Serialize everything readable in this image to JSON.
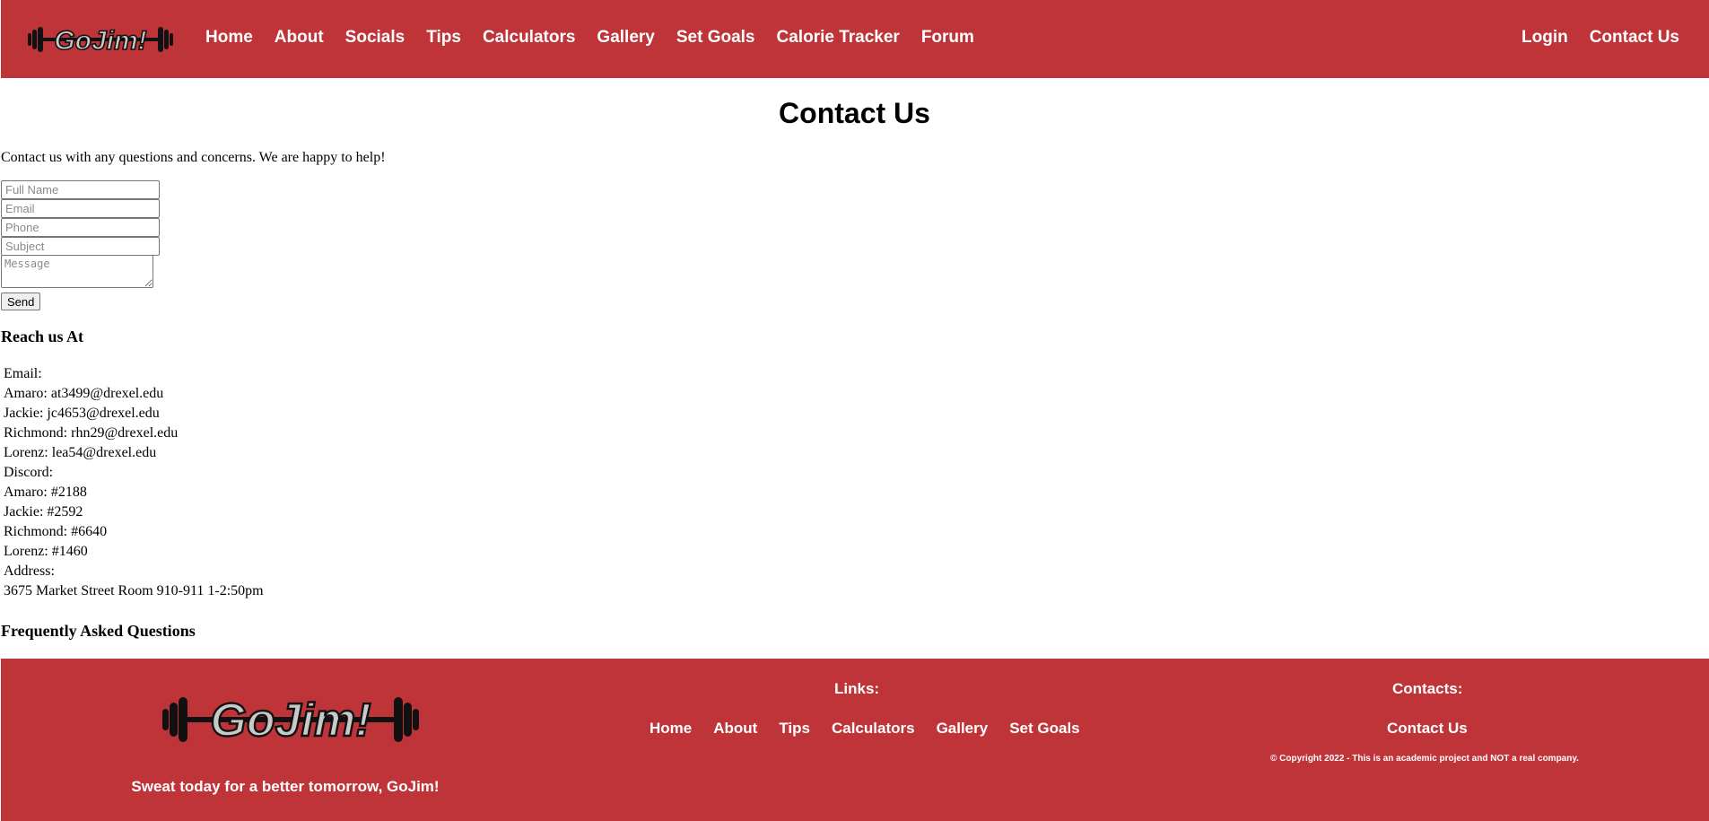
{
  "brand": {
    "logo_text": "GoJim!"
  },
  "nav": {
    "links": [
      "Home",
      "About",
      "Socials",
      "Tips",
      "Calculators",
      "Gallery",
      "Set Goals",
      "Calorie Tracker",
      "Forum"
    ],
    "right": [
      "Login",
      "Contact Us"
    ]
  },
  "main": {
    "title": "Contact Us",
    "intro": "Contact us with any questions and concerns. We are happy to help!",
    "form": {
      "full_name_placeholder": "Full Name",
      "email_placeholder": "Email",
      "phone_placeholder": "Phone",
      "subject_placeholder": "Subject",
      "message_placeholder": "Message",
      "send_label": "Send"
    },
    "reach_title": "Reach us At",
    "contact_lines": [
      "Email:",
      "Amaro: at3499@drexel.edu",
      "Jackie: jc4653@drexel.edu",
      "Richmond: rhn29@drexel.edu",
      "Lorenz: lea54@drexel.edu",
      "Discord:",
      "Amaro: #2188",
      "Jackie: #2592",
      "Richmond: #6640",
      "Lorenz: #1460",
      "Address:",
      "3675 Market Street Room 910-911 1-2:50pm"
    ],
    "faq_title": "Frequently Asked Questions"
  },
  "footer": {
    "tagline": "Sweat today for a better tomorrow, GoJim!",
    "links_title": "Links:",
    "links": [
      "Home",
      "About",
      "Tips",
      "Calculators",
      "Gallery",
      "Set Goals"
    ],
    "contacts_title": "Contacts:",
    "contact_link": "Contact Us",
    "copyright": "© Copyright 2022 - This is an academic project and NOT a real company."
  },
  "colors": {
    "brand_red": "#bf3438",
    "text_white": "#ffffff"
  }
}
